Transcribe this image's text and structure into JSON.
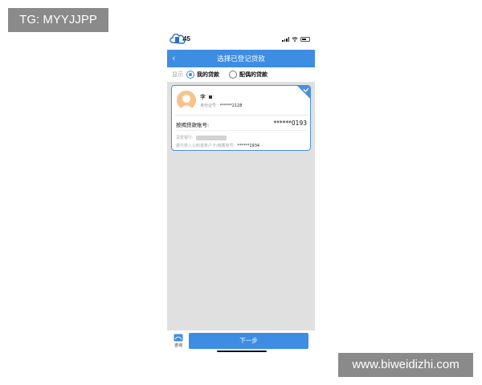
{
  "watermarks": {
    "top_left": "TG: MYYJJPP",
    "bottom_right": "www.biweidizhi.com"
  },
  "statusbar": {
    "time": "45",
    "icons": [
      "signal-icon",
      "wifi-icon",
      "battery-icon"
    ]
  },
  "navbar": {
    "back_glyph": "‹",
    "title": "选择已登记贷款"
  },
  "filter": {
    "label": "显示",
    "options": [
      {
        "label": "我的贷款",
        "selected": true
      },
      {
        "label": "配偶的贷款",
        "selected": false
      }
    ]
  },
  "loan_card": {
    "name": "李",
    "id_label": "身份证号:",
    "id_value": "******2128",
    "account_label": "按揭贷款账号:",
    "account_value": "******0193",
    "bank_label": "贷款银行:",
    "repay_label": "委托转入公积金账户卡/储蓄账号:",
    "repay_value": "******1934",
    "selected": true
  },
  "bottom": {
    "help_label": "咨询",
    "next_label": "下一步"
  },
  "colors": {
    "primary": "#3d8de3",
    "avatar": "#f7c28b",
    "list_bg": "#e0e0e0"
  }
}
